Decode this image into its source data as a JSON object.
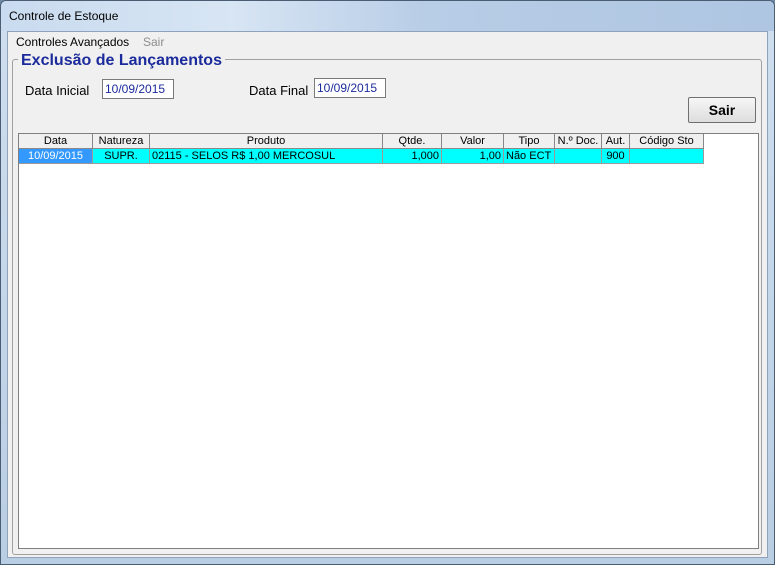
{
  "window": {
    "title": "Controle de Estoque"
  },
  "menu": {
    "advanced": "Controles Avançados",
    "exit": "Sair"
  },
  "form": {
    "heading": "Exclusão de Lançamentos",
    "start_label": "Data Inicial",
    "start_value": "10/09/2015",
    "end_label": "Data Final",
    "end_value": "10/09/2015",
    "exit_button": "Sair"
  },
  "table": {
    "columns": [
      "Data",
      "Natureza",
      "Produto",
      "Qtde.",
      "Valor",
      "Tipo",
      "N.º Doc.",
      "Aut.",
      "Código Sto"
    ],
    "rows": [
      [
        "10/09/2015",
        "SUPR.",
        "02115 - SELOS R$ 1,00 MERCOSUL",
        "1,000",
        "1,00",
        "Não ECT",
        "",
        "900",
        ""
      ]
    ]
  }
}
